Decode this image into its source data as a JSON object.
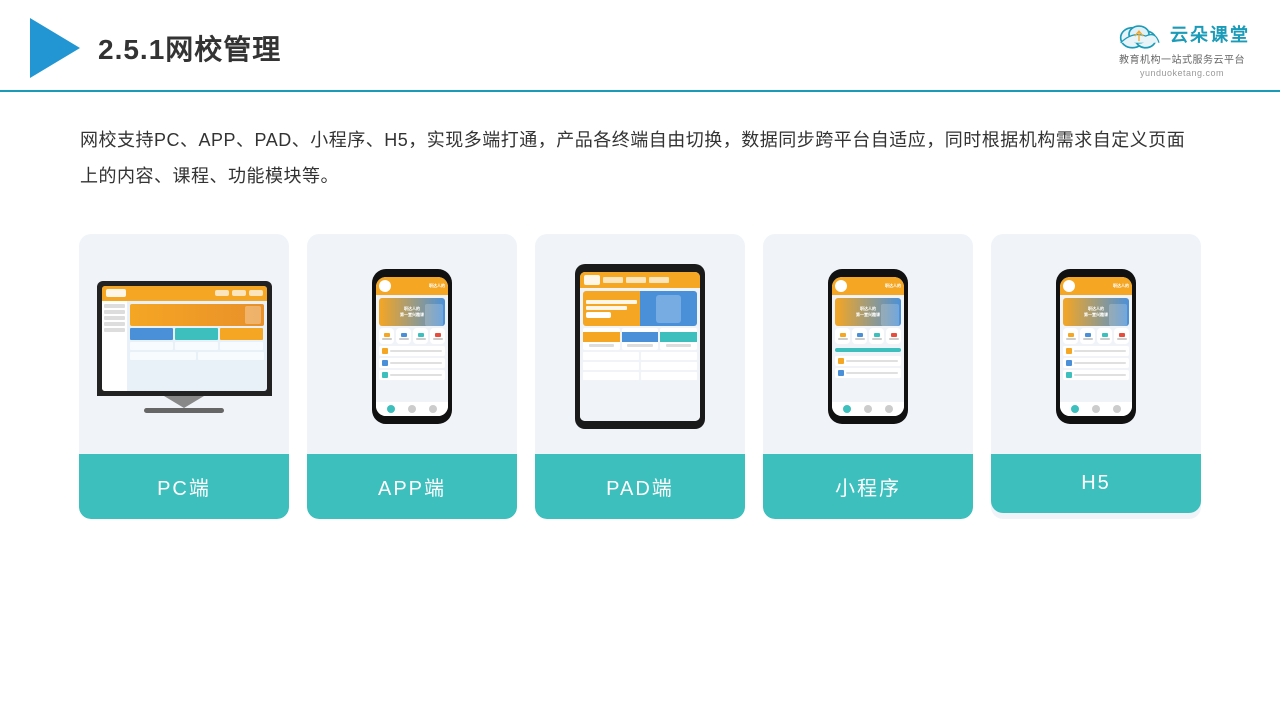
{
  "header": {
    "title": "2.5.1网校管理",
    "brand": {
      "name": "云朵课堂",
      "tagline": "教育机构一站式服务云平台",
      "url": "yunduoketang.com"
    }
  },
  "description": {
    "text": "网校支持PC、APP、PAD、小程序、H5，实现多端打通，产品各终端自由切换，数据同步跨平台自适应，同时根据机构需求自定义页面上的内容、课程、功能模块等。"
  },
  "cards": [
    {
      "id": "pc",
      "label": "PC端"
    },
    {
      "id": "app",
      "label": "APP端"
    },
    {
      "id": "pad",
      "label": "PAD端"
    },
    {
      "id": "miniprogram",
      "label": "小程序"
    },
    {
      "id": "h5",
      "label": "H5"
    }
  ],
  "colors": {
    "accent": "#3dbfbd",
    "header_line": "#1a9bb8",
    "brand_blue": "#1a9bb8",
    "title_color": "#333333",
    "text_color": "#333333",
    "card_bg": "#f0f4f8",
    "label_bg": "#3dbfbd"
  }
}
